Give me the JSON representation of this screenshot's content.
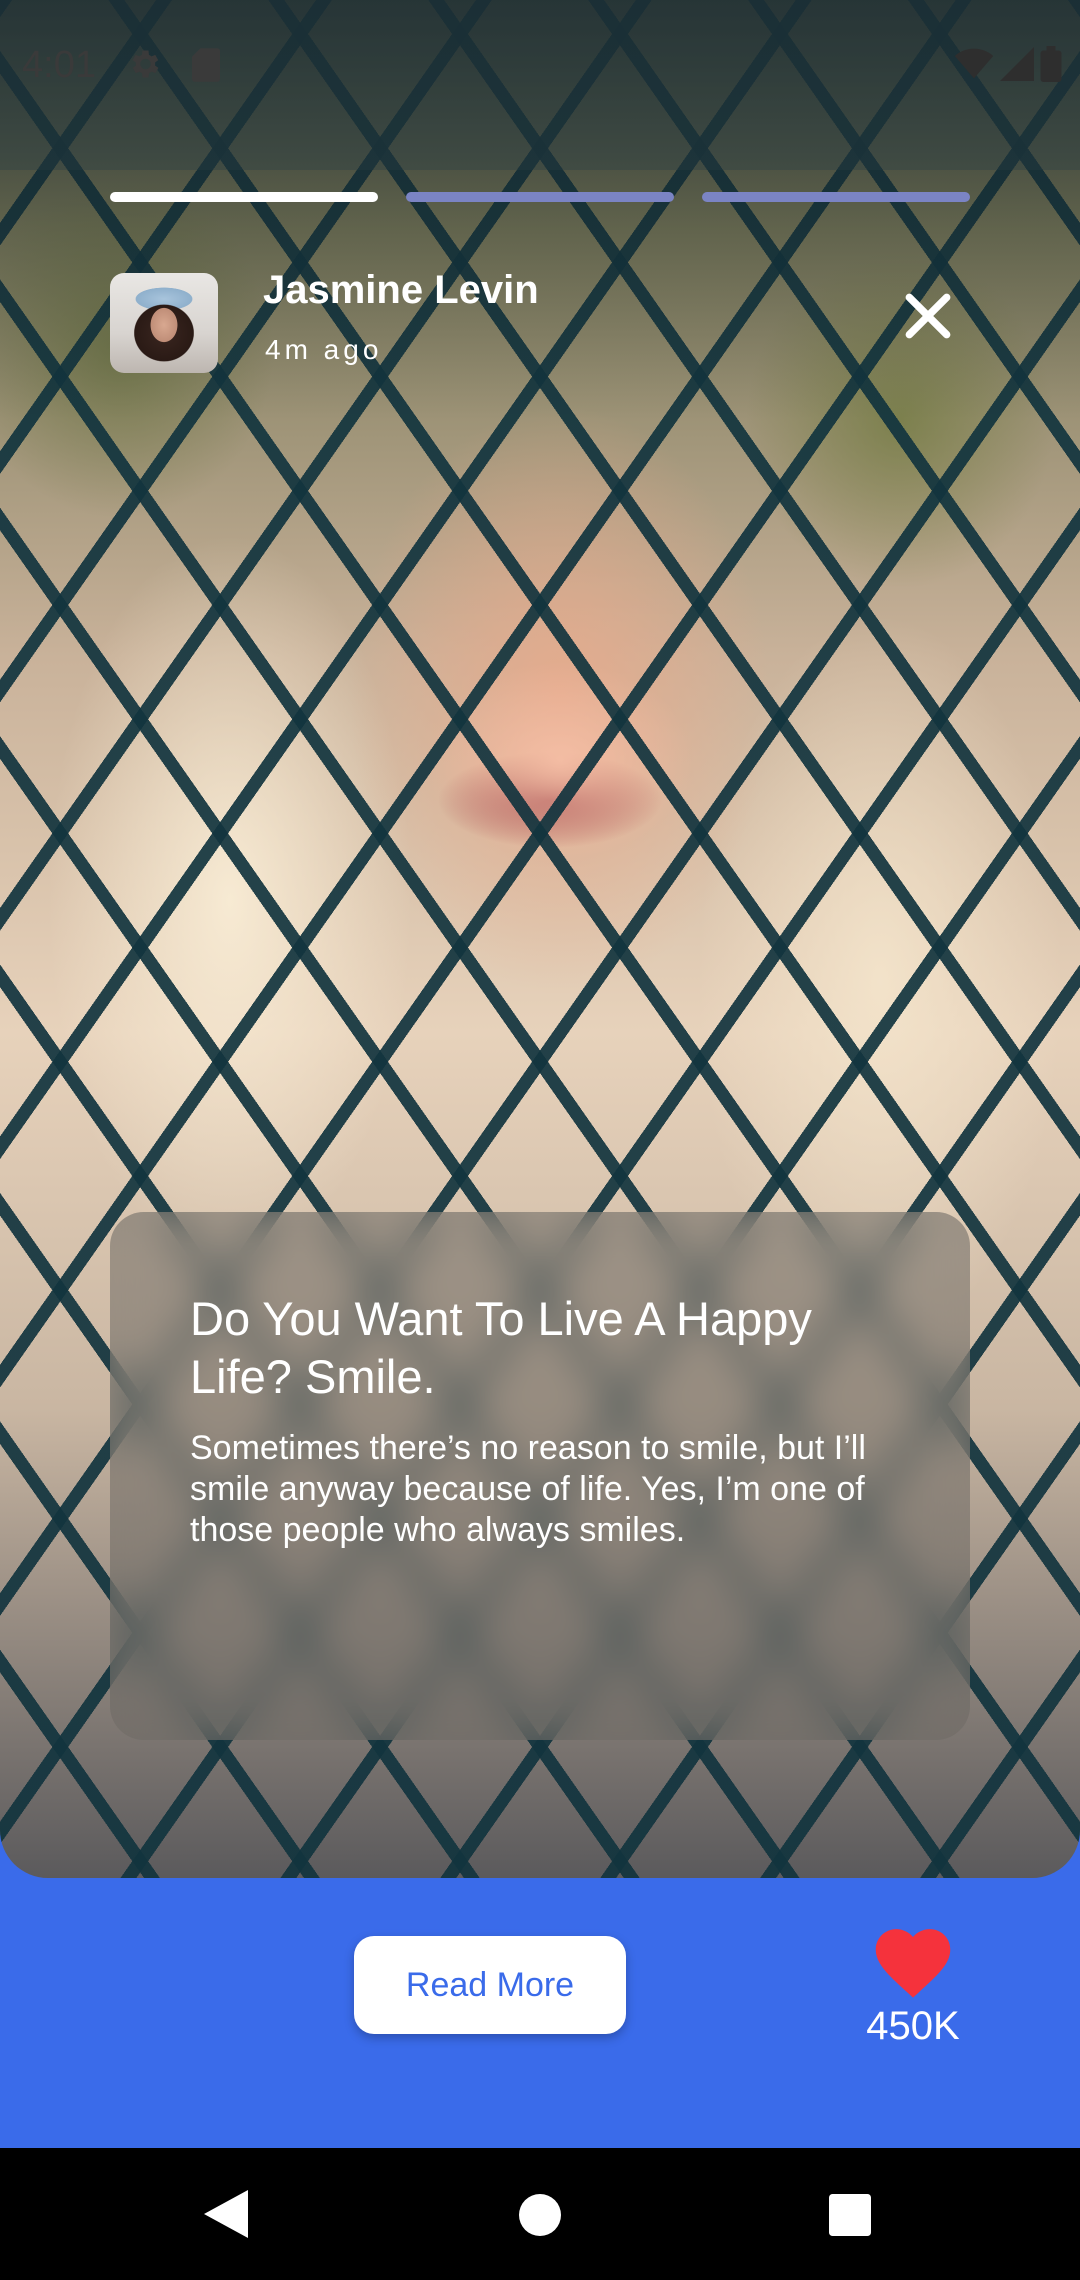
{
  "status_bar": {
    "time": "4:01",
    "icons": [
      "gear-icon",
      "sd-card-icon",
      "wifi-icon",
      "signal-icon",
      "battery-icon"
    ]
  },
  "story": {
    "progress": {
      "segments": 3,
      "active_index": 0
    },
    "user_name": "Jasmine Levin",
    "posted": "4m ago",
    "close_icon": "close-icon",
    "card": {
      "title": "Do You Want To Live A Happy Life? Smile.",
      "body": "Sometimes there’s no reason to smile, but I’ll smile anyway because of life. Yes, I’m one of those people who always smiles."
    }
  },
  "actions": {
    "read_more_label": "Read More",
    "likes_count": "450K",
    "heart_icon": "heart-icon"
  },
  "nav_bar": {
    "buttons": [
      "back-icon",
      "home-icon",
      "recents-icon"
    ]
  },
  "colors": {
    "accent": "#3a6bea",
    "heart": "#f5323c",
    "progress_active": "#ffffff",
    "progress_inactive": "#7b84c4"
  }
}
